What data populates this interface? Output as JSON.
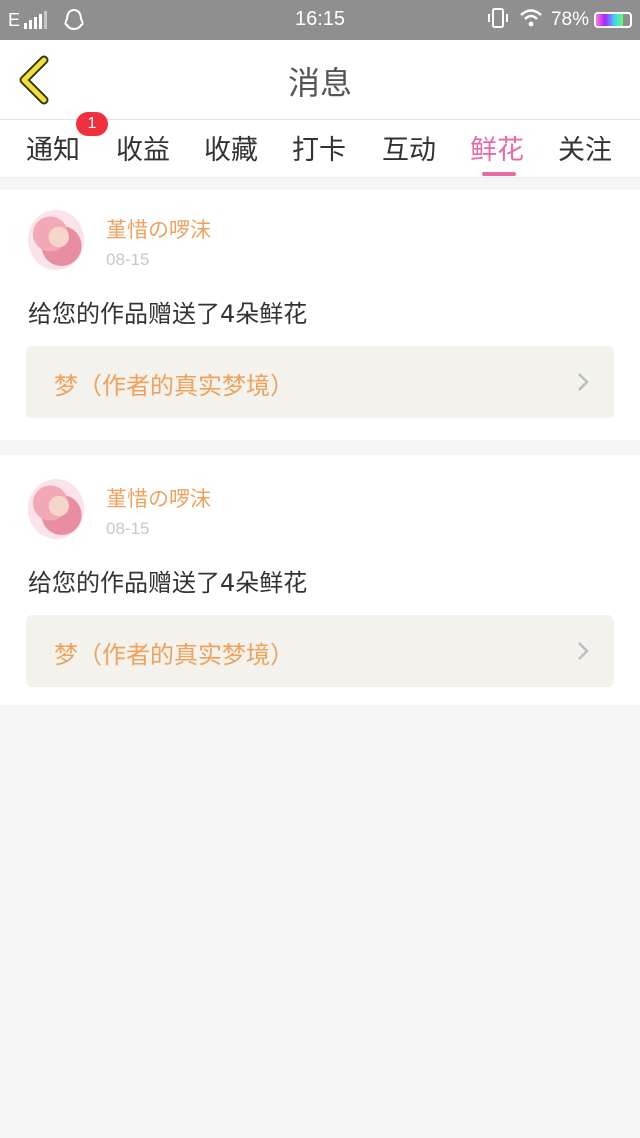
{
  "status_bar": {
    "network": "E",
    "time": "16:15",
    "battery": "78%",
    "battery_level": 0.78
  },
  "nav": {
    "title": "消息",
    "back_icon": "chevron-left-icon"
  },
  "tabs": [
    {
      "label": "通知",
      "badge": "1"
    },
    {
      "label": "收益"
    },
    {
      "label": "收藏"
    },
    {
      "label": "打卡"
    },
    {
      "label": "互动"
    },
    {
      "label": "鲜花",
      "active": true
    },
    {
      "label": "关注"
    }
  ],
  "messages": [
    {
      "user": "堇惜の啰沫",
      "date": "08-15",
      "text": "给您的作品赠送了4朵鲜花",
      "work_title": "梦（作者的真实梦境）"
    },
    {
      "user": "堇惜の啰沫",
      "date": "08-15",
      "text": "给您的作品赠送了4朵鲜花",
      "work_title": "梦（作者的真实梦境）"
    }
  ],
  "colors": {
    "accent": "#e76aa5",
    "username": "#f0a15c",
    "badge": "#f0303e"
  }
}
